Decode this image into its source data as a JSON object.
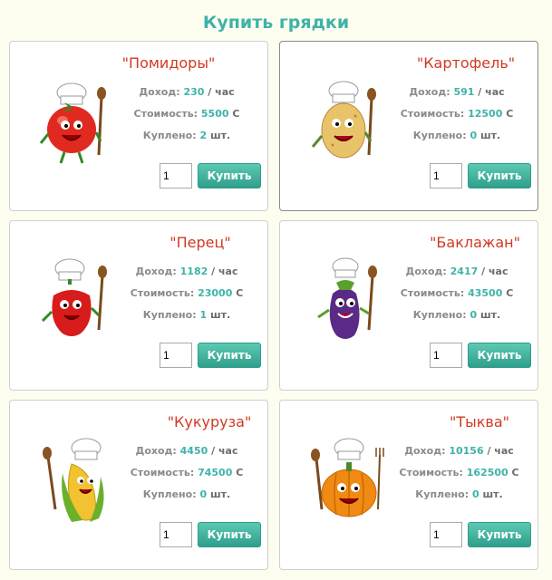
{
  "page": {
    "title": "Купить грядки"
  },
  "labels": {
    "income": "Доход:",
    "per_hour": "/ час",
    "cost": "Стоимость:",
    "currency": "С",
    "bought": "Куплено:",
    "pieces": "шт.",
    "buy": "Купить"
  },
  "beds": [
    {
      "name": "\"Помидоры\"",
      "income": "230",
      "cost": "5500",
      "bought": "2",
      "qty": "1",
      "color": "#e02a1f"
    },
    {
      "name": "\"Картофель\"",
      "income": "591",
      "cost": "12500",
      "bought": "0",
      "qty": "1",
      "color": "#e8c36a"
    },
    {
      "name": "\"Перец\"",
      "income": "1182",
      "cost": "23000",
      "bought": "1",
      "qty": "1",
      "color": "#d81b1b"
    },
    {
      "name": "\"Баклажан\"",
      "income": "2417",
      "cost": "43500",
      "bought": "0",
      "qty": "1",
      "color": "#5a2a86"
    },
    {
      "name": "\"Кукуруза\"",
      "income": "4450",
      "cost": "74500",
      "bought": "0",
      "qty": "1",
      "color": "#f2c230"
    },
    {
      "name": "\"Тыква\"",
      "income": "10156",
      "cost": "162500",
      "bought": "0",
      "qty": "1",
      "color": "#f08a12"
    }
  ]
}
